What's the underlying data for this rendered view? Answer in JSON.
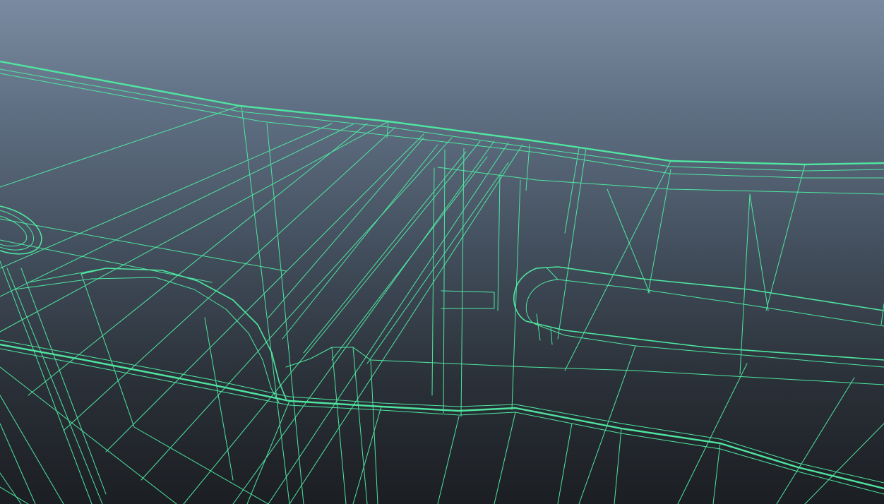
{
  "viewport": {
    "type": "3d-wireframe-viewport",
    "shading_mode": "wireframe",
    "wire_color": "#4ee6a0",
    "background_top_color": "#7a8aa0",
    "background_bottom_color": "#1b1e22"
  }
}
